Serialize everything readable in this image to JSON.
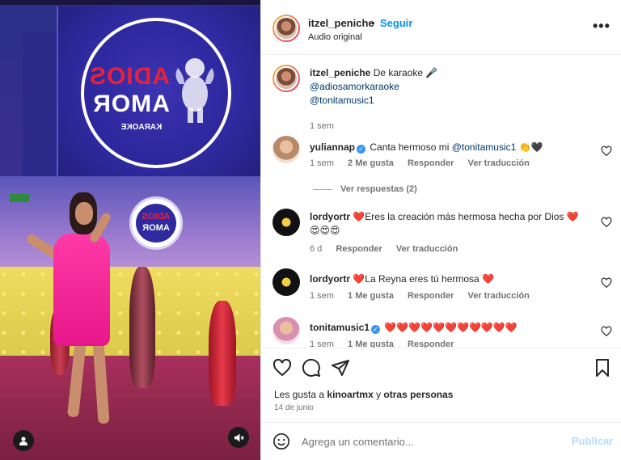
{
  "media": {
    "logo_word1": "ADIOS",
    "logo_word2": "AMOR",
    "logo_sub": "KARAOKE",
    "sign_word1": "ADIOS",
    "sign_word2": "AMOR",
    "user_tag_icon": "user-tag-icon",
    "mute_icon": "speaker-muted-icon"
  },
  "header": {
    "username": "itzel_peniche",
    "separator": "•",
    "follow_label": "Seguir",
    "audio": "Audio original",
    "more_icon": "more-options-icon",
    "more_glyph": "•••"
  },
  "caption": {
    "username": "itzel_peniche",
    "text": "De karaoke 🎤",
    "mention1": "@adiosamorkaraoke",
    "mention2": "@tonitamusic1",
    "time": "1 sem"
  },
  "comments": [
    {
      "username": "yuliannap",
      "verified": true,
      "text_before": "Canta hermoso mi ",
      "mention": "@tonitamusic1",
      "text_after": " 👏🖤",
      "time": "1 sem",
      "likes": "2 Me gusta",
      "reply": "Responder",
      "translate": "Ver traducción",
      "view_replies": "Ver respuestas (2)"
    },
    {
      "username": "lordyortr",
      "text_line1": "❤️Eres la creación más hermosa hecha por Dios ❤️",
      "text_line2": "😍😍😍",
      "time": "6 d",
      "reply": "Responder",
      "translate": "Ver traducción"
    },
    {
      "username": "lordyortr",
      "text": "❤️La Reyna eres tú hermosa ❤️",
      "time": "1 sem",
      "likes": "1 Me gusta",
      "reply": "Responder",
      "translate": "Ver traducción"
    },
    {
      "username": "tonitamusic1",
      "verified": true,
      "text": "❤️❤️❤️❤️❤️❤️❤️❤️❤️❤️❤️",
      "time": "1 sem",
      "likes": "1 Me gusta",
      "reply": "Responder"
    }
  ],
  "actions": {
    "like_icon": "heart-icon",
    "comment_icon": "comment-icon",
    "share_icon": "send-icon",
    "save_icon": "bookmark-icon",
    "likes_prefix": "Les gusta a ",
    "likes_user": "kinoartmx",
    "likes_connector": " y ",
    "likes_others": "otras personas",
    "date": "14 de junio"
  },
  "add_comment": {
    "emoji_icon": "emoji-icon",
    "placeholder": "Agrega un comentario...",
    "post_label": "Publicar"
  },
  "colors": {
    "link_blue": "#0095f6",
    "mention_blue": "#00376b",
    "muted_text": "#737373",
    "post_disabled": "#b3dbff",
    "verified_blue": "#3897f0"
  }
}
